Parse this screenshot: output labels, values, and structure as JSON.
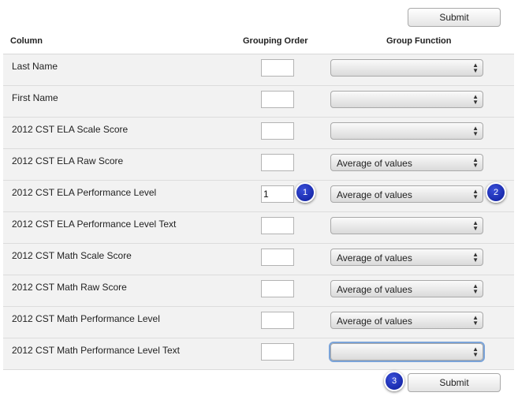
{
  "buttons": {
    "submit_top": "Submit",
    "submit_bottom": "Submit"
  },
  "headers": {
    "column": "Column",
    "grouping_order": "Grouping Order",
    "group_function": "Group Function"
  },
  "rows": [
    {
      "label": "Last Name",
      "order": "",
      "func": ""
    },
    {
      "label": "First Name",
      "order": "",
      "func": ""
    },
    {
      "label": "2012 CST ELA Scale Score",
      "order": "",
      "func": ""
    },
    {
      "label": "2012 CST ELA Raw Score",
      "order": "",
      "func": "Average of values"
    },
    {
      "label": "2012 CST ELA Performance Level",
      "order": "1",
      "func": "Average of values"
    },
    {
      "label": "2012 CST ELA Performance Level Text",
      "order": "",
      "func": ""
    },
    {
      "label": "2012 CST Math Scale Score",
      "order": "",
      "func": "Average of values"
    },
    {
      "label": "2012 CST Math Raw Score",
      "order": "",
      "func": "Average of values"
    },
    {
      "label": "2012 CST Math Performance Level",
      "order": "",
      "func": "Average of values"
    },
    {
      "label": "2012 CST Math Performance Level Text",
      "order": "",
      "func": ""
    }
  ],
  "badges": {
    "one": "1",
    "two": "2",
    "three": "3"
  },
  "icons": {
    "select_arrow": "up-down-arrows-icon"
  },
  "colors": {
    "badge": "#1a2bb8",
    "row_bg": "#f2f2f2"
  }
}
